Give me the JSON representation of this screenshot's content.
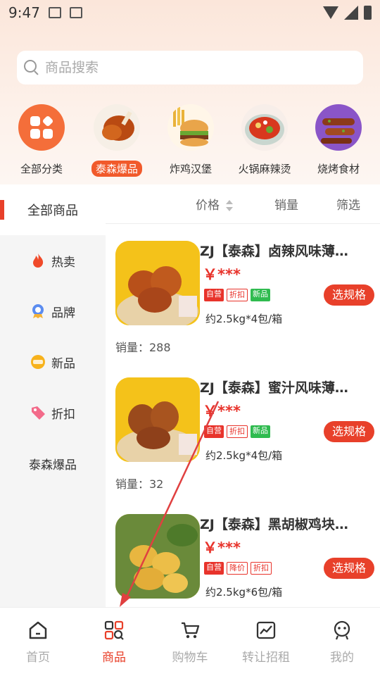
{
  "status_bar": {
    "time": "9:47"
  },
  "search": {
    "placeholder": "商品搜索"
  },
  "categories": [
    {
      "label": "全部分类",
      "active": false
    },
    {
      "label": "泰森爆品",
      "active": true
    },
    {
      "label": "炸鸡汉堡",
      "active": false
    },
    {
      "label": "火锅麻辣烫",
      "active": false
    },
    {
      "label": "烧烤食材",
      "active": false
    }
  ],
  "left_nav": {
    "items": [
      {
        "label": "全部商品",
        "icon": "none",
        "active": true
      },
      {
        "label": "热卖",
        "icon": "flame-icon",
        "active": false
      },
      {
        "label": "品牌",
        "icon": "badge-icon",
        "active": false
      },
      {
        "label": "新品",
        "icon": "new-icon",
        "active": false
      },
      {
        "label": "折扣",
        "icon": "tag-icon",
        "active": false
      },
      {
        "label": "泰森爆品",
        "icon": "none",
        "active": false
      }
    ]
  },
  "sort_bar": {
    "price": "价格",
    "sales": "销量",
    "filter": "筛选"
  },
  "products": [
    {
      "title": "ZJ【泰森】卤辣风味薄…",
      "price": "￥***",
      "tags": [
        "自营",
        "折扣",
        "新品"
      ],
      "spec": "约2.5kg*4包/箱",
      "button": "选规格",
      "sales": "销量：288"
    },
    {
      "title": "ZJ【泰森】蜜汁风味薄…",
      "price": "￥***",
      "tags": [
        "自营",
        "折扣",
        "新品"
      ],
      "spec": "约2.5kg*4包/箱",
      "button": "选规格",
      "sales": "销量：32"
    },
    {
      "title": "ZJ【泰森】黑胡椒鸡块…",
      "price": "￥***",
      "tags": [
        "自营",
        "降价",
        "折扣"
      ],
      "spec": "约2.5kg*6包/箱",
      "button": "选规格",
      "sales": ""
    }
  ],
  "bottom_nav": {
    "items": [
      {
        "label": "首页",
        "icon": "home-icon",
        "active": false
      },
      {
        "label": "商品",
        "icon": "products-icon",
        "active": true
      },
      {
        "label": "购物车",
        "icon": "cart-icon",
        "active": false
      },
      {
        "label": "转让招租",
        "icon": "chart-icon",
        "active": false
      },
      {
        "label": "我的",
        "icon": "profile-icon",
        "active": false
      }
    ]
  },
  "colors": {
    "accent": "#e8402a",
    "price": "#e8332b",
    "green_tag": "#2fbb4f"
  }
}
